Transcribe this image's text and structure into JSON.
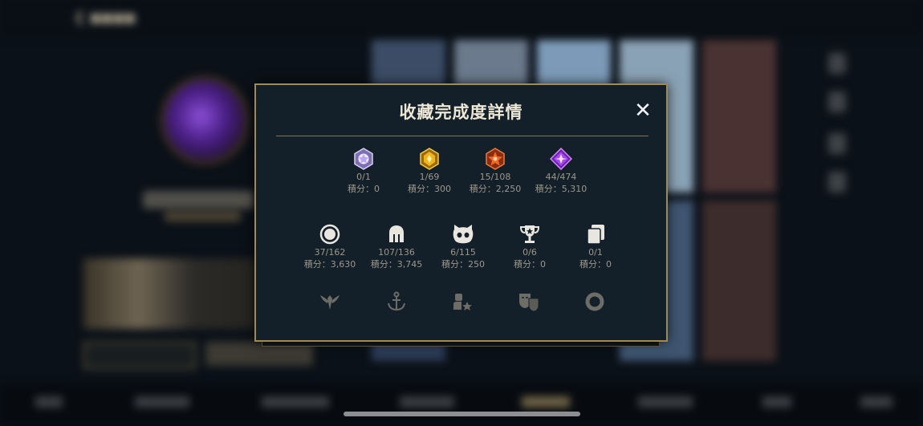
{
  "modal": {
    "title": "收藏完成度詳情",
    "close_icon": "close-icon",
    "gem_row": [
      {
        "icon": "purple-white-gem-icon",
        "count": "0/1",
        "score": "積分：0"
      },
      {
        "icon": "gold-gem-icon",
        "count": "1/69",
        "score": "積分：300"
      },
      {
        "icon": "orange-gem-icon",
        "count": "15/108",
        "score": "積分：2,250"
      },
      {
        "icon": "purple-gem-icon",
        "count": "44/474",
        "score": "積分：5,310"
      }
    ],
    "category_row": [
      {
        "icon": "circle-icon",
        "count": "37/162",
        "score": "積分：3,630"
      },
      {
        "icon": "helmet-icon",
        "count": "107/136",
        "score": "積分：3,745"
      },
      {
        "icon": "cat-face-icon",
        "count": "6/115",
        "score": "積分：250"
      },
      {
        "icon": "trophy-icon",
        "count": "0/6",
        "score": "積分：0"
      },
      {
        "icon": "cards-icon",
        "count": "0/1",
        "score": "積分：0"
      }
    ],
    "locked_row": [
      "wings-emblem-icon",
      "anchor-icon",
      "person-star-icon",
      "masks-icon",
      "ring-icon"
    ]
  },
  "colors": {
    "modal_bg": "#13202a",
    "modal_border": "#a08a52",
    "title": "#ede7d6",
    "stat_text": "#9c9789",
    "gem_purple": "#8f3cd8",
    "gem_gold": "#e3a514",
    "gem_orange": "#d8531f"
  }
}
